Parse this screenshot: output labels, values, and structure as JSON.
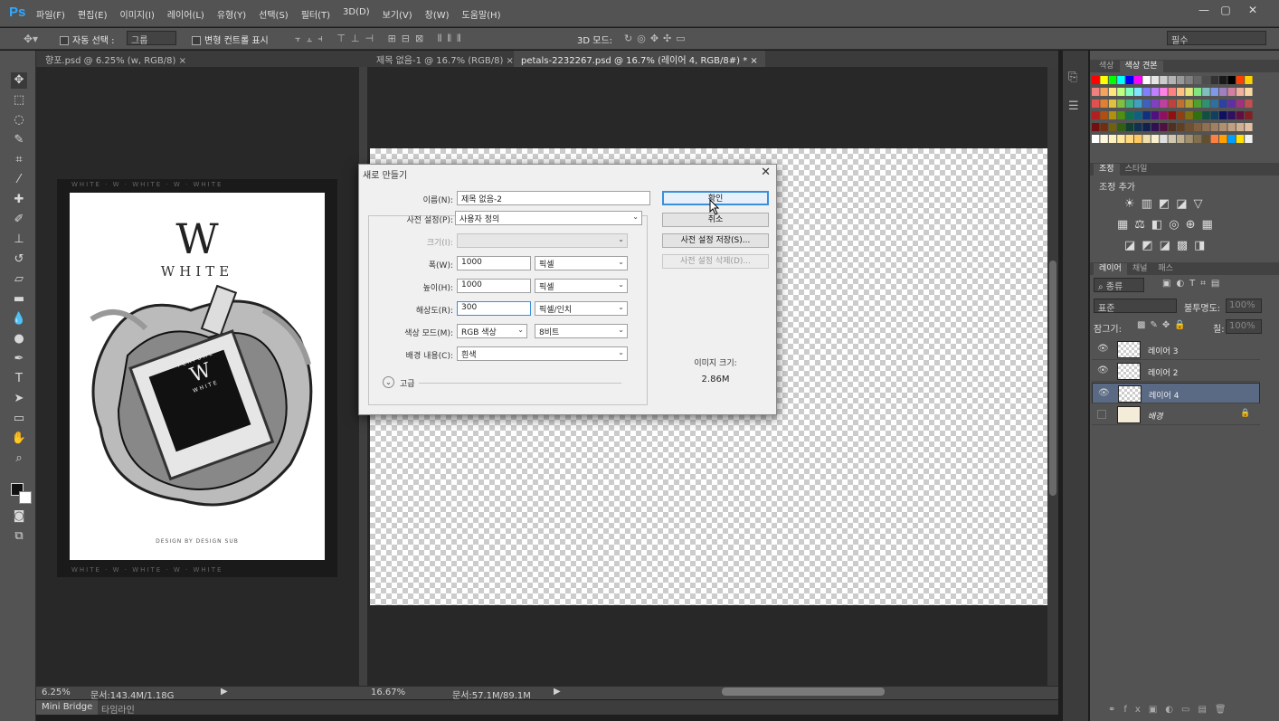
{
  "app": {
    "logo": "Ps"
  },
  "menu": [
    "파일(F)",
    "편집(E)",
    "이미지(I)",
    "레이어(L)",
    "유형(Y)",
    "선택(S)",
    "필터(T)",
    "3D(D)",
    "보기(V)",
    "창(W)",
    "도움말(H)"
  ],
  "window_controls": {
    "min": "—",
    "max": "▢",
    "close": "✕"
  },
  "options": {
    "auto_select_label": "자동 선택 :",
    "auto_select_value": "그룹",
    "transform_label": "변형 컨트롤 표시",
    "mode_3d": "3D 모드:",
    "workspace": "필수"
  },
  "tabs": [
    {
      "label": "향포.psd @ 6.25% (w, RGB/8)",
      "close": "×"
    },
    {
      "label": "제목 없음-1 @ 16.7% (RGB/8)",
      "close": "×"
    },
    {
      "label": "petals-2232267.psd @ 16.7% (레이어 4, RGB/8#) *",
      "close": "×"
    }
  ],
  "poster": {
    "logo": "W",
    "brand": "WHITE",
    "label_top": "PERFUME",
    "label_logo": "W",
    "label_bottom": "WHITE",
    "credit": "DESIGN BY DESIGN SUB",
    "frame_text": "WHITE · W · WHITE · W · WHITE"
  },
  "status_left": {
    "zoom": "6.25%",
    "doc": "문서:143.4M/1.18G"
  },
  "status_right": {
    "zoom": "16.67%",
    "doc": "문서:57.1M/89.1M"
  },
  "bottom_tabs": [
    "Mini Bridge",
    "타임라인"
  ],
  "dialog": {
    "title": "새로 만들기",
    "close": "✕",
    "name_label": "이름(N):",
    "name_value": "제목 없음-2",
    "preset_label": "사전 설정(P):",
    "preset_value": "사용자 정의",
    "size_label": "크기(I):",
    "size_value": "",
    "width_label": "폭(W):",
    "width_value": "1000",
    "width_unit": "픽셀",
    "height_label": "높이(H):",
    "height_value": "1000",
    "height_unit": "픽셀",
    "res_label": "해상도(R):",
    "res_value": "300",
    "res_unit": "픽셀/인치",
    "color_label": "색상 모드(M):",
    "color_value": "RGB 색상",
    "color_bits": "8비트",
    "bg_label": "배경 내용(C):",
    "bg_value": "흰색",
    "advanced": "고급",
    "ok": "확인",
    "cancel": "취소",
    "save_preset": "사전 설정 저장(S)...",
    "delete_preset": "사전 설정 삭제(D)...",
    "image_size_label": "이미지 크기:",
    "image_size_value": "2.86M"
  },
  "panels": {
    "color_tabs": [
      "색상",
      "색상 견본"
    ],
    "adjust_tabs": [
      "조정",
      "스타일"
    ],
    "adjust_add": "조정 추가",
    "layer_tabs": [
      "레이어",
      "채널",
      "패스"
    ],
    "kind": "종류",
    "blend": "표준",
    "opacity_label": "불투명도:",
    "opacity_value": "100%",
    "lock_label": "잠그기:",
    "fill_label": "칠:",
    "fill_value": "100%",
    "layers": [
      {
        "name": "레이어 3",
        "selected": false,
        "visible": true
      },
      {
        "name": "레이어 2",
        "selected": false,
        "visible": true
      },
      {
        "name": "레이어 4",
        "selected": true,
        "visible": true
      },
      {
        "name": "배경",
        "selected": false,
        "visible": false
      }
    ]
  },
  "colors": {
    "ui_bg": "#535353",
    "accent": "#31a8ff",
    "dialog_bg": "#f0f0f0",
    "selected_layer": "#5a6a85"
  }
}
